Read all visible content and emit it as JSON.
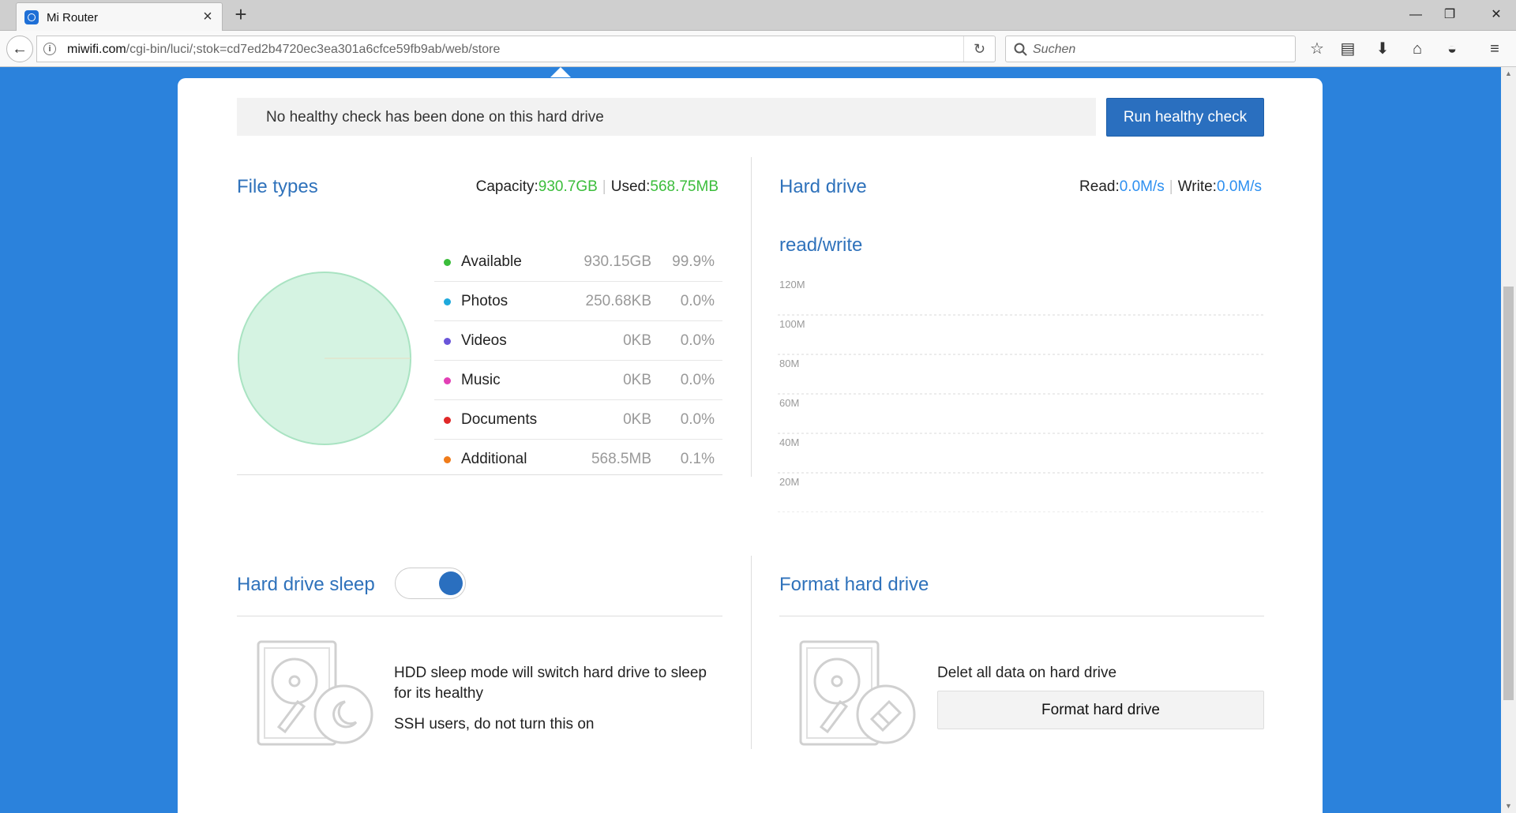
{
  "browser": {
    "tab_title": "Mi Router",
    "url_domain": "miwifi.com",
    "url_path": "/cgi-bin/luci/;stok=cd7ed2b4720ec3ea301a6cfce59fb9ab/web/store",
    "search_placeholder": "Suchen"
  },
  "banner": {
    "message": "No healthy check has been done on this hard drive",
    "button_label": "Run healthy check"
  },
  "file_types": {
    "title": "File types",
    "capacity_label": "Capacity:",
    "capacity_value": "930.7GB",
    "used_label": "Used:",
    "used_value": "568.75MB",
    "items": [
      {
        "name": "Available",
        "size": "930.15GB",
        "percent": "99.9%",
        "color": "#3bbd3b"
      },
      {
        "name": "Photos",
        "size": "250.68KB",
        "percent": "0.0%",
        "color": "#1ea9dc"
      },
      {
        "name": "Videos",
        "size": "0KB",
        "percent": "0.0%",
        "color": "#6a55d9"
      },
      {
        "name": "Music",
        "size": "0KB",
        "percent": "0.0%",
        "color": "#e23fb5"
      },
      {
        "name": "Documents",
        "size": "0KB",
        "percent": "0.0%",
        "color": "#e02828"
      },
      {
        "name": "Additional",
        "size": "568.5MB",
        "percent": "0.1%",
        "color": "#f07c1a"
      }
    ]
  },
  "hard_drive": {
    "title": "Hard drive",
    "read_label": "Read:",
    "read_value": "0.0M/s",
    "write_label": "Write:",
    "write_value": "0.0M/s",
    "chart_title": "read/write"
  },
  "chart_data": {
    "type": "line",
    "title": "read/write",
    "y_ticks": [
      "120M",
      "100M",
      "80M",
      "60M",
      "40M",
      "20M"
    ],
    "ylim": [
      0,
      120
    ],
    "series": [
      {
        "values": [
          0
        ]
      }
    ]
  },
  "sleep": {
    "title": "Hard drive sleep",
    "toggle_on": true,
    "desc_line1": "HDD sleep mode will switch hard drive to sleep",
    "desc_line2": "for its healthy",
    "desc_line3": "SSH users, do not turn this on"
  },
  "format": {
    "title": "Format hard drive",
    "desc": "Delet all data on hard drive",
    "button_label": "Format hard drive"
  },
  "colors": {
    "accent": "#2f72bb",
    "primary_button": "#2a6fbf",
    "page_background": "#2b82dc",
    "green": "#3bbd3b",
    "blue_value": "#2c8ff0"
  }
}
